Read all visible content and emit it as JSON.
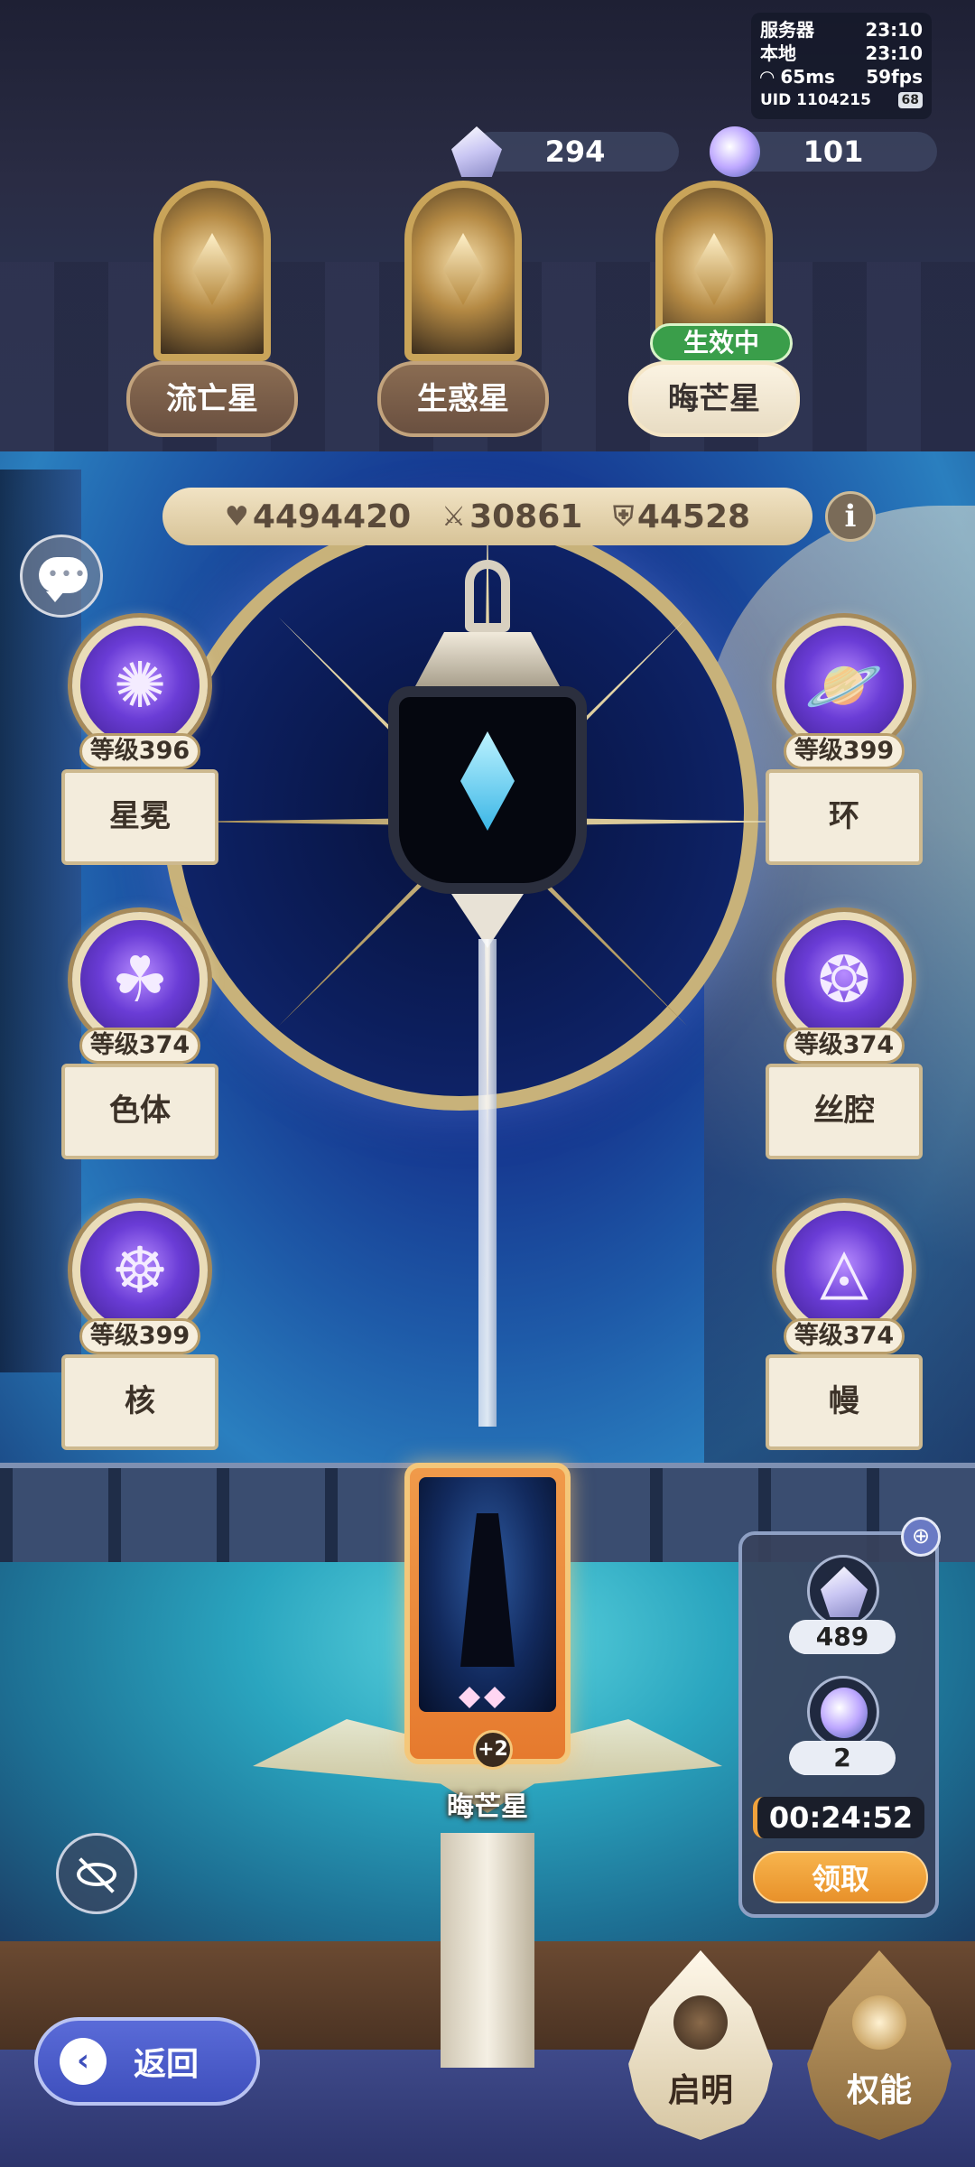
{
  "status": {
    "server_label": "服务器",
    "server_time": "23:10",
    "local_label": "本地",
    "local_time": "23:10",
    "ping": "65ms",
    "fps": "59fps",
    "uid": "UID 1104215",
    "battery": "68"
  },
  "currencies": [
    {
      "icon": "crystal-icon",
      "value": "294"
    },
    {
      "icon": "orb-icon",
      "value": "101"
    }
  ],
  "stars": [
    {
      "label": "流亡星",
      "active": false
    },
    {
      "label": "生惑星",
      "active": false
    },
    {
      "label": "晦芒星",
      "active": true,
      "badge": "生效中"
    }
  ],
  "stats": {
    "hp": "4494420",
    "atk": "30861",
    "def": "44528",
    "info_icon": "i"
  },
  "nodes": [
    {
      "level": "等级396",
      "name": "星冕",
      "icon": "sun-icon"
    },
    {
      "level": "等级399",
      "name": "环",
      "icon": "planet-ring-icon"
    },
    {
      "level": "等级374",
      "name": "色体",
      "icon": "triquetra-icon"
    },
    {
      "level": "等级374",
      "name": "丝腔",
      "icon": "swirl-icon"
    },
    {
      "level": "等级399",
      "name": "核",
      "icon": "wheel-icon"
    },
    {
      "level": "等级374",
      "name": "幔",
      "icon": "triangle-eye-icon"
    }
  ],
  "card": {
    "name": "晦芒星",
    "plus": "+2"
  },
  "rewards": {
    "items": [
      {
        "icon": "crystal-icon",
        "count": "489"
      },
      {
        "icon": "orb-icon",
        "count": "2"
      }
    ],
    "timer": "00:24:52",
    "claim_label": "领取"
  },
  "nav": {
    "back_label": "返回",
    "enlighten_label": "启明",
    "authority_label": "权能"
  },
  "colors": {
    "accent_gold": "#c9a459",
    "active_green": "#3a9e4a",
    "claim_orange": "#f0a23c",
    "node_purple": "#6a3cd6"
  }
}
